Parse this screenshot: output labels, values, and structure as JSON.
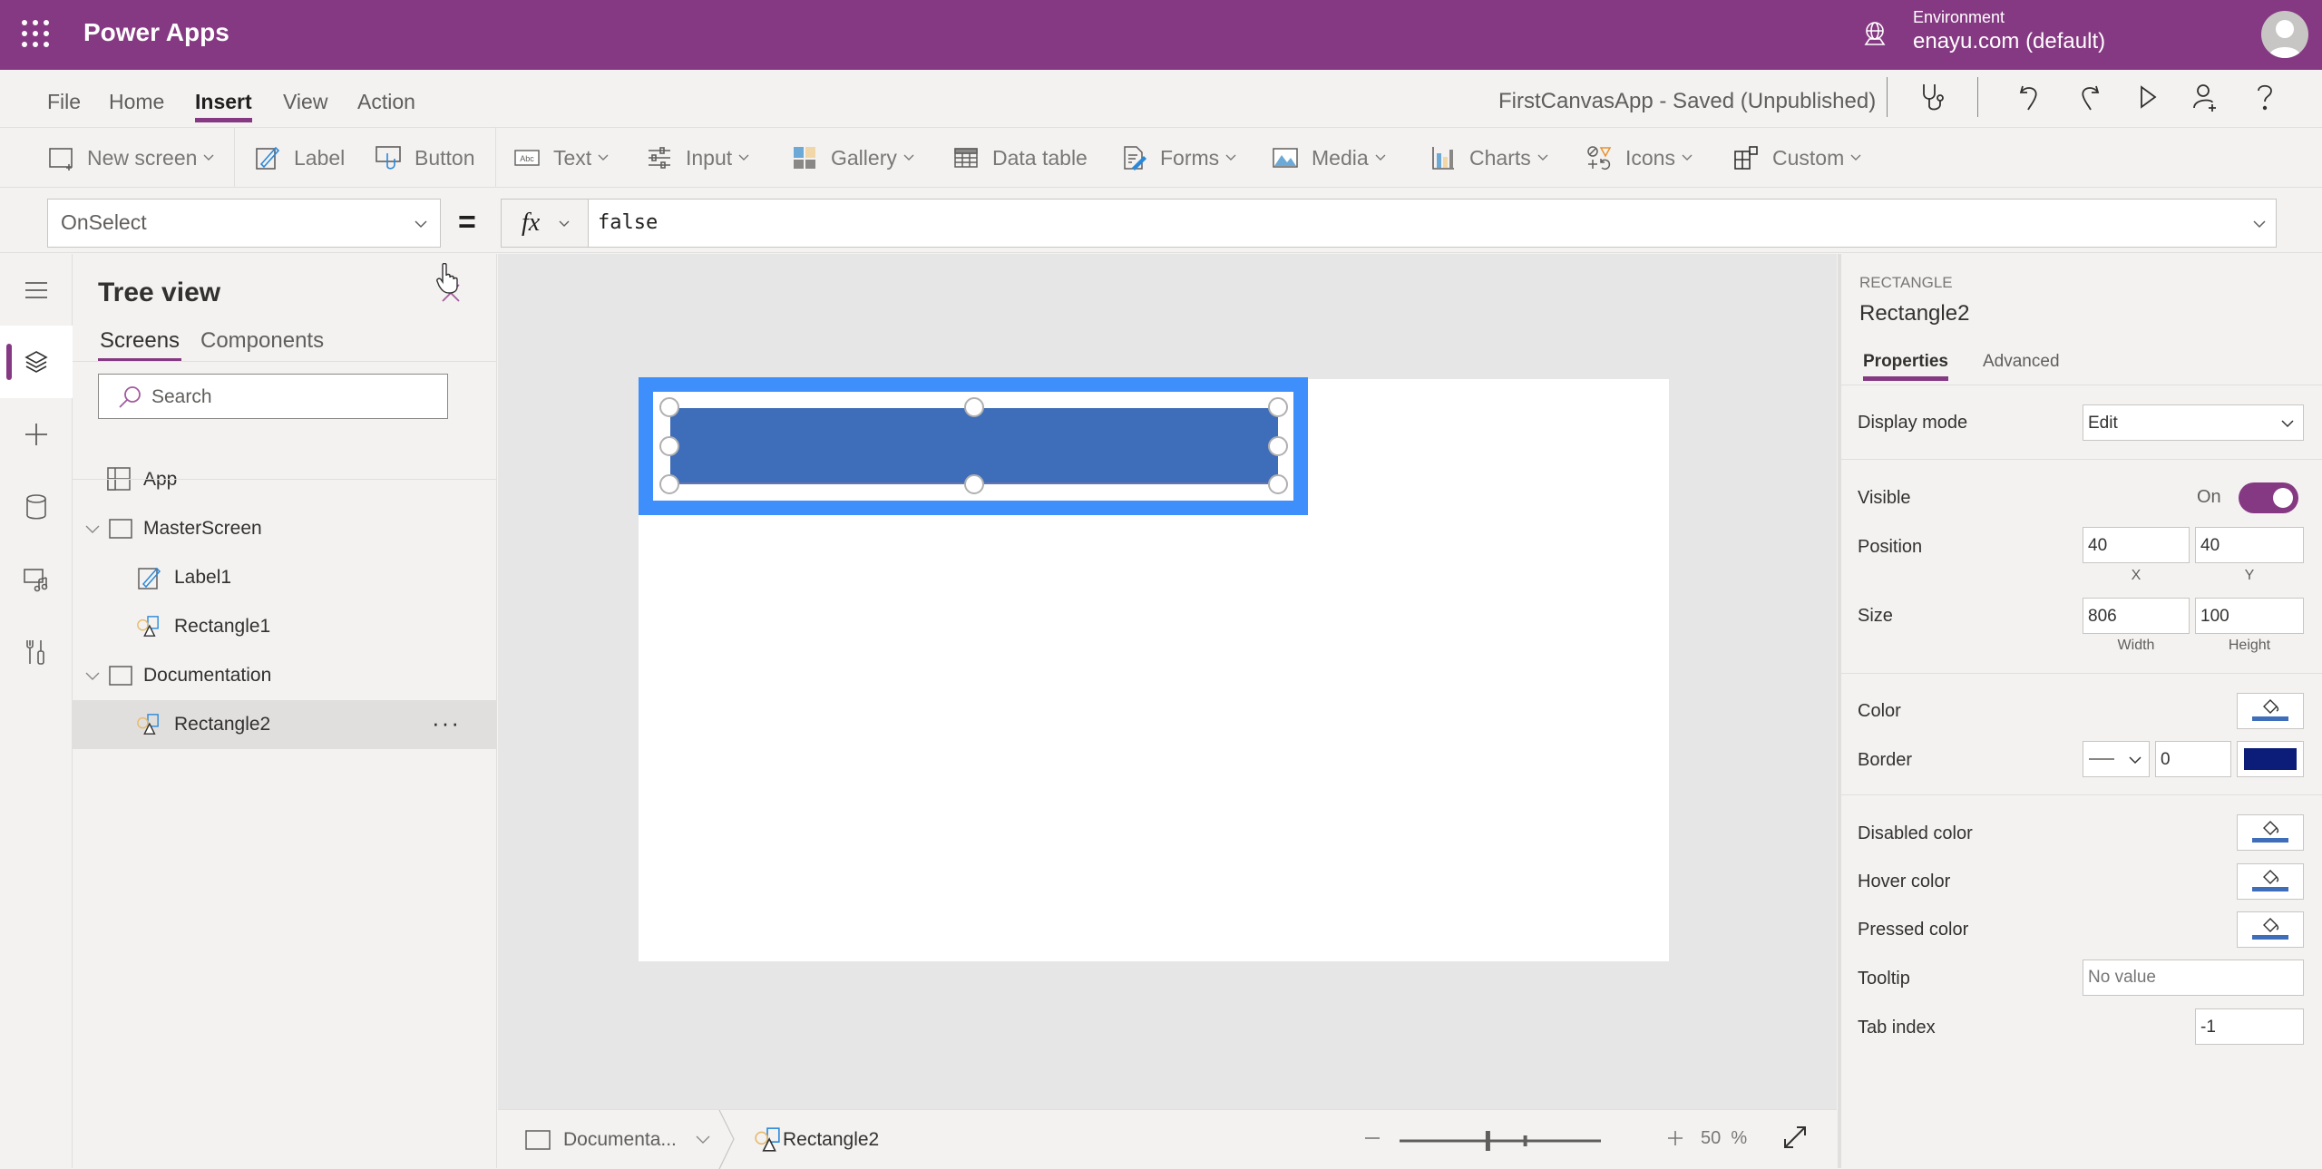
{
  "header": {
    "app_name": "Power Apps",
    "environment_label": "Environment",
    "environment_value": "enayu.com (default)",
    "brand_color": "#853982"
  },
  "menu": {
    "tabs": [
      {
        "label": "File",
        "active": false
      },
      {
        "label": "Home",
        "active": false
      },
      {
        "label": "Insert",
        "active": true
      },
      {
        "label": "View",
        "active": false
      },
      {
        "label": "Action",
        "active": false
      }
    ],
    "app_status": "FirstCanvasApp - Saved (Unpublished)",
    "icons": [
      "app-checker-stethoscope-icon",
      "undo-icon",
      "redo-icon",
      "play-preview-icon",
      "share-user-icon",
      "help-icon"
    ]
  },
  "ribbon": {
    "new_screen": "New screen",
    "label": "Label",
    "button": "Button",
    "text": "Text",
    "input": "Input",
    "gallery": "Gallery",
    "data_table": "Data table",
    "forms": "Forms",
    "media": "Media",
    "charts": "Charts",
    "icons": "Icons",
    "custom": "Custom"
  },
  "formula_bar": {
    "property": "OnSelect",
    "equals": "=",
    "fx": "fx",
    "formula": "false"
  },
  "tree_view": {
    "title": "Tree view",
    "tabs": [
      {
        "label": "Screens",
        "active": true
      },
      {
        "label": "Components",
        "active": false
      }
    ],
    "search_placeholder": "Search",
    "app_item": "App",
    "items": [
      {
        "label": "MasterScreen",
        "type": "screen",
        "level": 0,
        "expanded": true
      },
      {
        "label": "Label1",
        "type": "label",
        "level": 1
      },
      {
        "label": "Rectangle1",
        "type": "shape",
        "level": 1
      },
      {
        "label": "Documentation",
        "type": "screen",
        "level": 0,
        "expanded": true
      },
      {
        "label": "Rectangle2",
        "type": "shape",
        "level": 1,
        "selected": true
      }
    ],
    "more_label": "···"
  },
  "canvas": {
    "selected_fill": "#3e6db9",
    "selection_color": "#3e8efb"
  },
  "status_bar": {
    "screen_crumb": "Documenta...",
    "control_crumb": "Rectangle2",
    "zoom_value": "50",
    "zoom_unit": "%",
    "zoom_percent": 50
  },
  "properties": {
    "control_type": "RECTANGLE",
    "control_name": "Rectangle2",
    "tabs": [
      {
        "label": "Properties",
        "active": true
      },
      {
        "label": "Advanced",
        "active": false
      }
    ],
    "display_mode_label": "Display mode",
    "display_mode_value": "Edit",
    "visible_label": "Visible",
    "visible_state": "On",
    "visible_on": true,
    "position_label": "Position",
    "x": "40",
    "y": "40",
    "x_label": "X",
    "y_label": "Y",
    "size_label": "Size",
    "width": "806",
    "height": "100",
    "width_label": "Width",
    "height_label": "Height",
    "color_label": "Color",
    "color_value": "#3e6db9",
    "border_label": "Border",
    "border_thickness": "0",
    "border_color": "#0b1d78",
    "disabled_color_label": "Disabled color",
    "hover_color_label": "Hover color",
    "pressed_color_label": "Pressed color",
    "tooltip_label": "Tooltip",
    "tooltip_placeholder": "No value",
    "tab_index_label": "Tab index",
    "tab_index_value": "-1"
  }
}
